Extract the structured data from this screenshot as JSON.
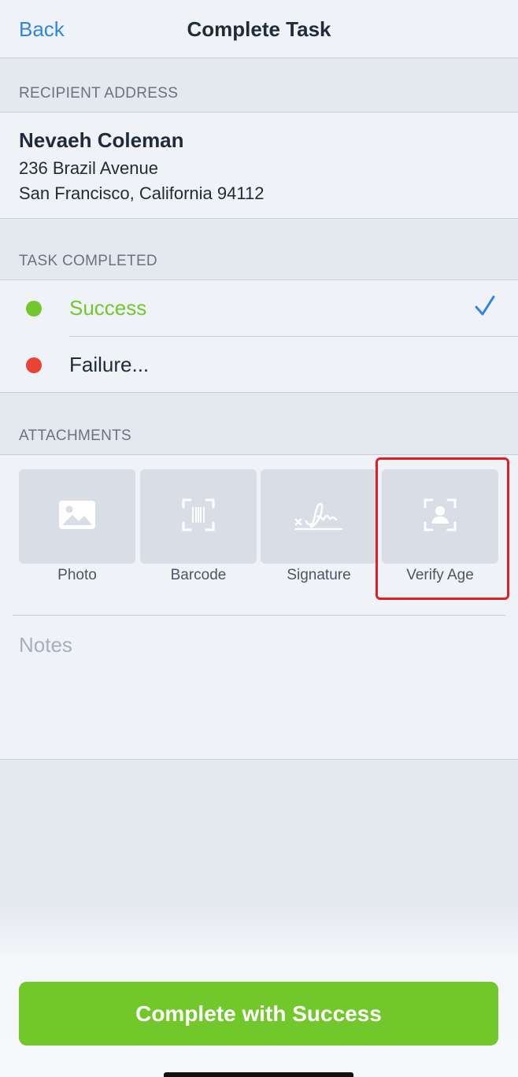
{
  "nav": {
    "back_label": "Back",
    "title": "Complete Task"
  },
  "recipient": {
    "header": "RECIPIENT ADDRESS",
    "name": "Nevaeh Coleman",
    "line1": "236 Brazil Avenue",
    "line2": "San Francisco, California 94112"
  },
  "task": {
    "header": "TASK COMPLETED",
    "options": [
      {
        "label": "Success",
        "color": "#72c82a",
        "selected": true,
        "icon": "checkmark-icon"
      },
      {
        "label": "Failure...",
        "color": "#ea4335",
        "selected": false
      }
    ]
  },
  "attachments": {
    "header": "ATTACHMENTS",
    "items": [
      {
        "label": "Photo",
        "icon": "photo-icon"
      },
      {
        "label": "Barcode",
        "icon": "barcode-icon"
      },
      {
        "label": "Signature",
        "icon": "signature-icon"
      },
      {
        "label": "Verify Age",
        "icon": "verify-age-icon",
        "highlighted": true
      }
    ]
  },
  "notes": {
    "placeholder": "Notes"
  },
  "cta": {
    "label": "Complete with Success"
  },
  "colors": {
    "accent": "#2f86e0",
    "success": "#72c82a",
    "failure": "#ea4335",
    "highlight": "#e01e26"
  }
}
